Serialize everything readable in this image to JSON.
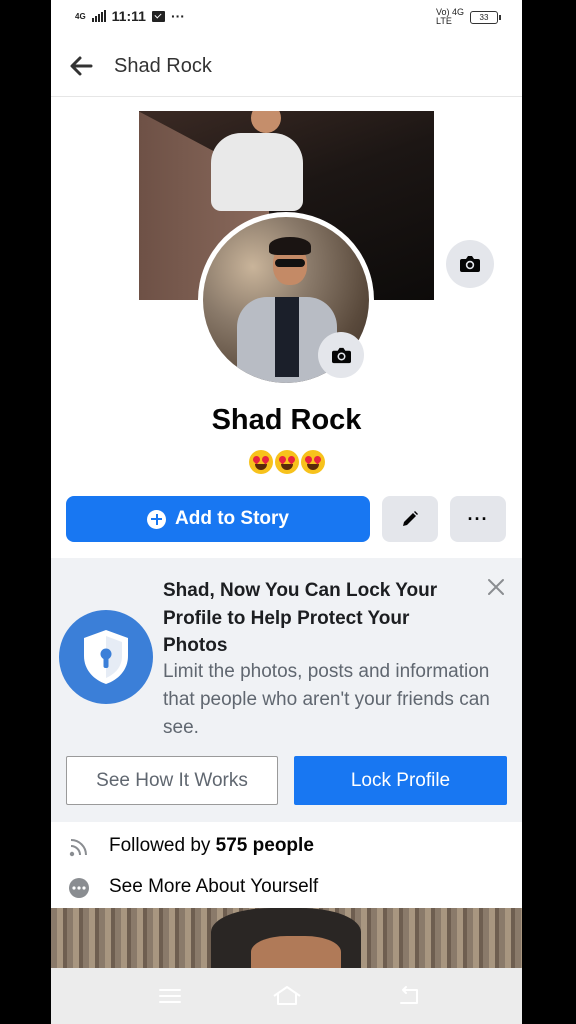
{
  "status_bar": {
    "network_left": "4G",
    "time": "11:11",
    "more": "···",
    "network_right_top": "Vo) 4G",
    "network_right_bottom": "LTE",
    "battery": "33"
  },
  "header": {
    "title": "Shad Rock"
  },
  "profile": {
    "name": "Shad Rock",
    "emoji_count": 3
  },
  "actions": {
    "add_story_label": "Add to Story",
    "more_label": "···"
  },
  "lock_card": {
    "title": "Shad, Now You Can Lock Your Profile to Help Protect Your Photos",
    "description": "Limit the photos, posts and information that people who aren't your friends can see.",
    "secondary_button": "See How It Works",
    "primary_button": "Lock Profile"
  },
  "info": {
    "followed_prefix": "Followed by ",
    "followed_count": "575 people",
    "see_more": "See More About Yourself"
  },
  "colors": {
    "accent": "#1877f2",
    "card_bg": "#f0f2f5",
    "shield": "#3b7fd8"
  }
}
